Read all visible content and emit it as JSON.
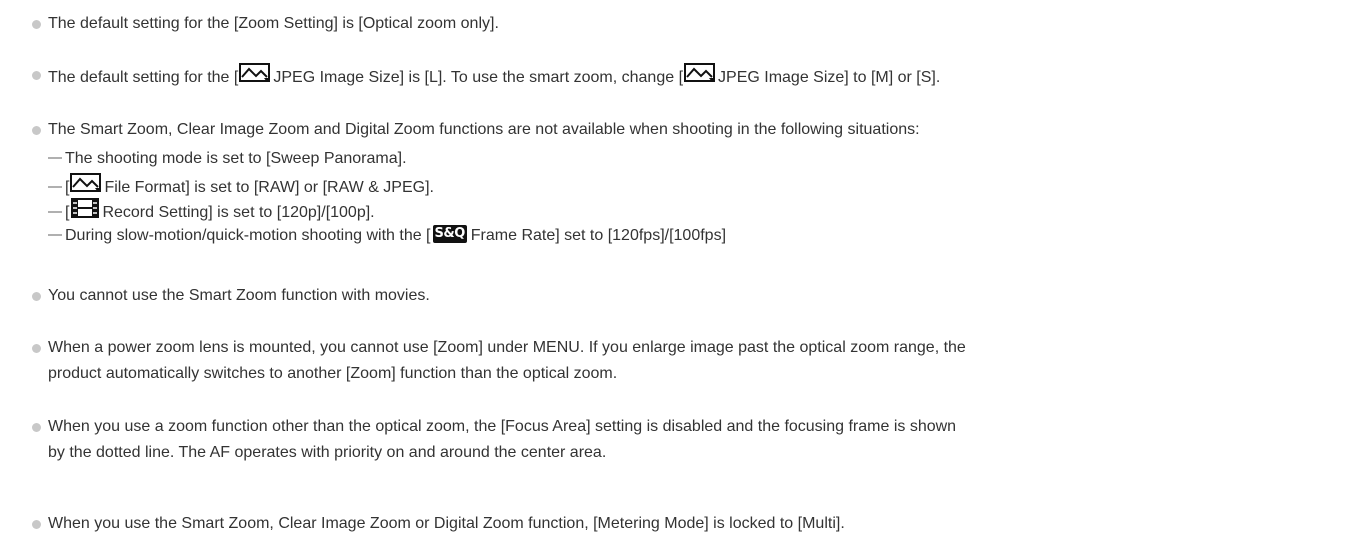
{
  "icons": {
    "photo": "photo-image-icon",
    "movie": "movie-film-icon",
    "sq": "S&Q"
  },
  "notes": [
    {
      "text": "The default setting for the [Zoom Setting] is [Optical zoom only]."
    },
    {
      "p1": "The default setting for the [",
      "p2": "JPEG Image Size] is [L]. To use the smart zoom, change [",
      "p3": "JPEG Image Size] to [M] or [S]."
    },
    {
      "text": "The Smart Zoom, Clear Image Zoom and Digital Zoom functions are not available when shooting in the following situations:",
      "subs": [
        {
          "text": "The shooting mode is set to [Sweep Panorama]."
        },
        {
          "p1": "[",
          "p2": "File Format] is set to [RAW] or [RAW & JPEG]."
        },
        {
          "p1": "[",
          "p2": "Record Setting] is set to [120p]/[100p]."
        },
        {
          "p1": "During slow-motion/quick-motion shooting with the [",
          "p2": "Frame Rate] set to [120fps]/[100fps]"
        }
      ]
    },
    {
      "text": "You cannot use the Smart Zoom function with movies."
    },
    {
      "l1": "When a power zoom lens is mounted, you cannot use [Zoom] under MENU. If you enlarge image past the optical zoom range, the",
      "l2": "product automatically switches to another [Zoom] function than the optical zoom."
    },
    {
      "l1": "When you use a zoom function other than the optical zoom, the [Focus Area] setting is disabled and the focusing frame is shown",
      "l2": "by the dotted line. The AF operates with priority on and around the center area."
    },
    {
      "text": "When you use the Smart Zoom, Clear Image Zoom or Digital Zoom function, [Metering Mode] is locked to [Multi]."
    }
  ]
}
